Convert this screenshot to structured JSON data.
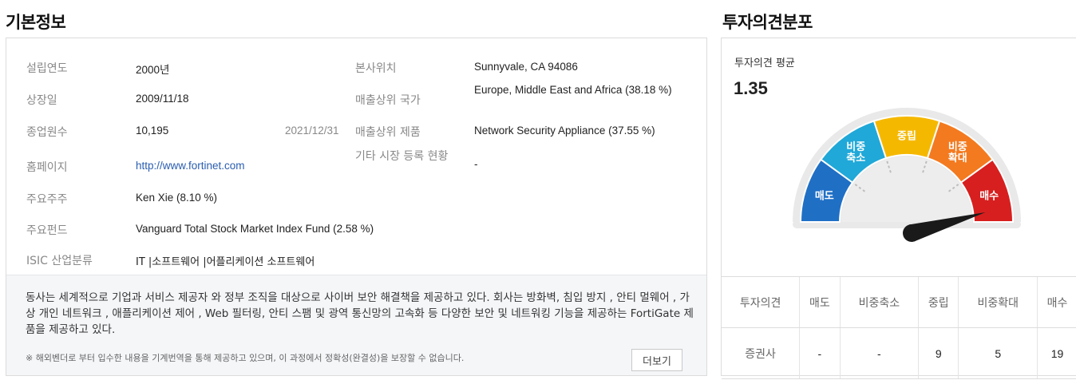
{
  "basic_info": {
    "title": "기본정보",
    "rows": [
      {
        "label": "설립연도",
        "value": "2000년",
        "label2": "본사위치",
        "value2": "Sunnyvale, CA 94086"
      },
      {
        "label": "상장일",
        "value": "2009/11/18",
        "label2": "매출상위 국가",
        "value2": "Europe, Middle East and Africa (38.18 %)"
      },
      {
        "label": "종업원수",
        "value": "10,195",
        "date": "2021/12/31",
        "label2": "매출상위 제품",
        "value2": "Network Security Appliance (37.55 %)"
      },
      {
        "label": "홈페이지",
        "value": "http://www.fortinet.com",
        "label2": "기타 시장 등록 현황",
        "value2": "-"
      },
      {
        "label": "주요주주",
        "value": "Ken Xie (8.10 %)"
      },
      {
        "label": "주요펀드",
        "value": "Vanguard Total Stock Market Index Fund (2.58 %)"
      },
      {
        "label": "ISIC 산업분류",
        "value": "IT |소프트웨어 |어플리케이션 소프트웨어"
      }
    ],
    "description": "동사는 세계적으로 기업과 서비스 제공자 와 정부 조직을 대상으로 사이버 보안 해결책을 제공하고 있다. 회사는 방화벽, 침입 방지 , 안티 멀웨어 , 가상 개인 네트워크 , 애플리케이션 제어 , Web 필터링, 안티 스팸 및 광역 통신망의 고속화 등 다양한 보안 및 네트워킹 기능을 제공하는 FortiGate 제품을 제공하고 있다.",
    "notice": "※ 해외벤더로 부터 입수한 내용을 기계번역을 통해 제공하고 있으며, 이 과정에서 정확성(완결성)을 보장할 수 없습니다.",
    "more_label": "더보기"
  },
  "opinion": {
    "title": "투자의견분포",
    "avg_label": "투자의견 평균",
    "avg_value": "1.35",
    "gauge_level": 1.35,
    "gauge_segments": [
      {
        "label": "매도",
        "color": "#1f6fc5"
      },
      {
        "label": "비중\n축소",
        "color": "#20a8d8"
      },
      {
        "label": "중립",
        "color": "#f5b800"
      },
      {
        "label": "비중\n확대",
        "color": "#f47a1f"
      },
      {
        "label": "매수",
        "color": "#d71f1f"
      }
    ],
    "table": {
      "headers": [
        "투자의견",
        "매도",
        "비중축소",
        "중립",
        "비중확대",
        "매수"
      ],
      "row_label": "증권사",
      "values": [
        "-",
        "-",
        "9",
        "5",
        "19"
      ]
    }
  }
}
